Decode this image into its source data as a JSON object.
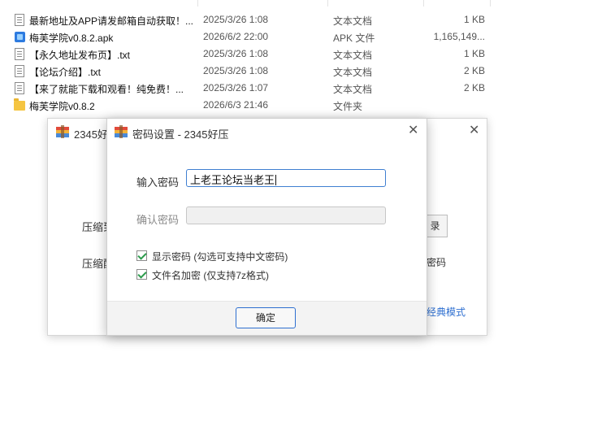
{
  "files": [
    {
      "name": "最新地址及APP请发邮箱自动获取！...",
      "date": "2025/3/26 1:08",
      "type": "文本文档",
      "size": "1 KB",
      "icon": "text-file-icon"
    },
    {
      "name": "梅芙学院v0.8.2.apk",
      "date": "2026/6/2 22:00",
      "type": "APK 文件",
      "size": "1,165,149...",
      "icon": "apk-file-icon"
    },
    {
      "name": "【永久地址发布页】.txt",
      "date": "2025/3/26 1:08",
      "type": "文本文档",
      "size": "1 KB",
      "icon": "text-file-icon"
    },
    {
      "name": "【论坛介绍】.txt",
      "date": "2025/3/26 1:08",
      "type": "文本文档",
      "size": "2 KB",
      "icon": "text-file-icon"
    },
    {
      "name": "【来了就能下载和观看！纯免费！...",
      "date": "2025/3/26 1:07",
      "type": "文本文档",
      "size": "2 KB",
      "icon": "text-file-icon"
    },
    {
      "name": "梅芙学院v0.8.2",
      "date": "2026/6/3 21:46",
      "type": "文件夹",
      "size": "",
      "icon": "folder-icon"
    }
  ],
  "back_dialog": {
    "title": "2345好",
    "label1": "压缩到",
    "label2": "压缩配",
    "btn_partial": "录",
    "pw_partial": "密码",
    "link": "经典模式",
    "close": "✕"
  },
  "front_dialog": {
    "title": "密码设置 - 2345好压",
    "close": "✕",
    "password_label": "输入密码",
    "password_value": "上老王论坛当老王",
    "confirm_label": "确认密码",
    "show_password": "显示密码 (勾选可支持中文密码)",
    "encrypt_names": "文件名加密  (仅支持7z格式)",
    "ok_button": "确定"
  },
  "colors": {
    "accent": "#2e6fd0",
    "check": "#2c9b4c"
  }
}
